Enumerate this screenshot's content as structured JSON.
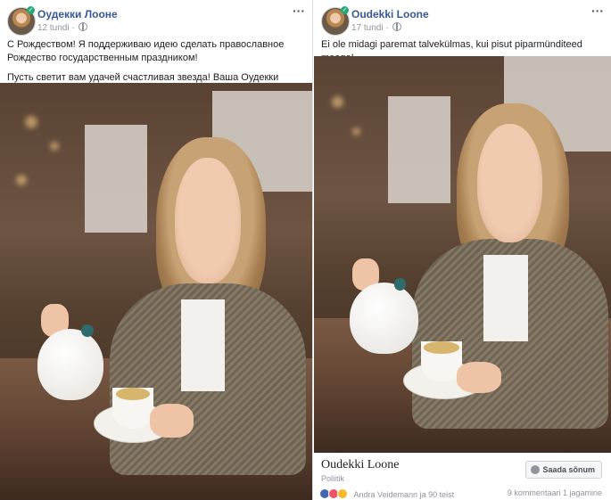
{
  "posts": [
    {
      "author": "Оудекки Лооне",
      "time": "12 tundi",
      "paragraphs": [
        "С Рождеством! Я поддерживаю идею сделать православное Рождество государственным праздником!",
        "Пусть светит вам удачей счастливая звезда! Ваша Оудекки Лооне."
      ]
    },
    {
      "author": "Oudekki Loone",
      "time": "17 tundi",
      "paragraphs": [
        "Ei ole midagi paremat talvekülmas, kui pisut piparmünditeed meega!"
      ],
      "page_name": "Oudekki Loone",
      "page_category": "Poliitik",
      "send_message_label": "Saada sõnum",
      "reactors": "Andra Veidemann ja 90 teist",
      "comments": "9 kommentaari",
      "shares": "1 jagamine"
    }
  ],
  "icons": {
    "more": "more-options-icon",
    "audience": "globe-icon",
    "messenger": "messenger-icon"
  },
  "colors": {
    "author_link": "#385898",
    "meta_text": "#90949c",
    "like": "#4267b2",
    "love": "#f25268",
    "wow": "#f7b928"
  }
}
